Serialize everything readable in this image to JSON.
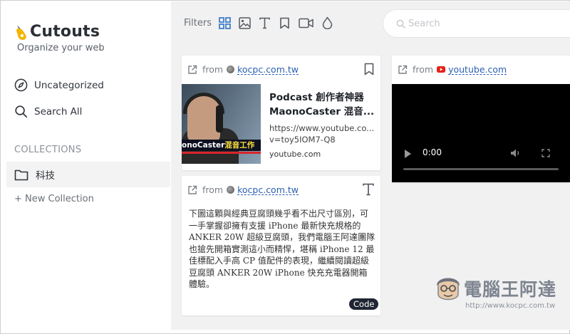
{
  "app": {
    "name": "Cutouts",
    "tagline": "Organize your web"
  },
  "sidebar": {
    "nav": [
      {
        "label": "Uncategorized",
        "icon": "compass-icon"
      },
      {
        "label": "Search All",
        "icon": "search-icon"
      }
    ],
    "collections_label": "COLLECTIONS",
    "collections": [
      {
        "label": "科技",
        "icon": "folder-icon"
      }
    ],
    "new_collection": "+ New Collection"
  },
  "toolbar": {
    "filters_label": "Filters",
    "filters": [
      "grid-icon",
      "image-icon",
      "text-icon",
      "bookmark-icon",
      "video-icon",
      "drop-icon"
    ],
    "search_placeholder": "Search"
  },
  "cards": [
    {
      "from": "from",
      "domain": "kocpc.com.tw",
      "type_icon": "bookmark-icon",
      "title": "Podcast 創作者神器 MaonoCaster 混音...",
      "url": "https://www.youtube.co... v=toy5IOM7-Q8",
      "site": "youtube.com",
      "thumb_caption_a": "onoCaster",
      "thumb_caption_b": "混音工作"
    },
    {
      "from": "from",
      "domain": "youtube.com",
      "type_icon": "video-icon",
      "time": "0:00"
    },
    {
      "from": "from",
      "domain": "kocpc.com.tw",
      "type_icon": "text-icon",
      "text": "下圖這顆與經典豆腐頭幾乎看不出尺寸區別，可一手掌握卻擁有支援 iPhone 最新快充規格的 ANKER 20W 超級豆腐頭，我們電腦王阿達團隊也搶先開箱實測這小而精悍，堪稱 iPhone 12 最佳標配入手高 CP 值配件的表現，繼續閱讀超級豆腐頭 ANKER 20W iPhone 快充充電器開箱體驗。",
      "badge": "Code"
    }
  ],
  "watermark": {
    "title": "電腦王阿達",
    "url": "http://www.kocpc.com.tw"
  },
  "colors": {
    "accent_blue": "#2a5fb0",
    "filter_active": "#3a78c9",
    "main_bg": "#f1f1f1",
    "badge_bg": "#1f2532"
  }
}
